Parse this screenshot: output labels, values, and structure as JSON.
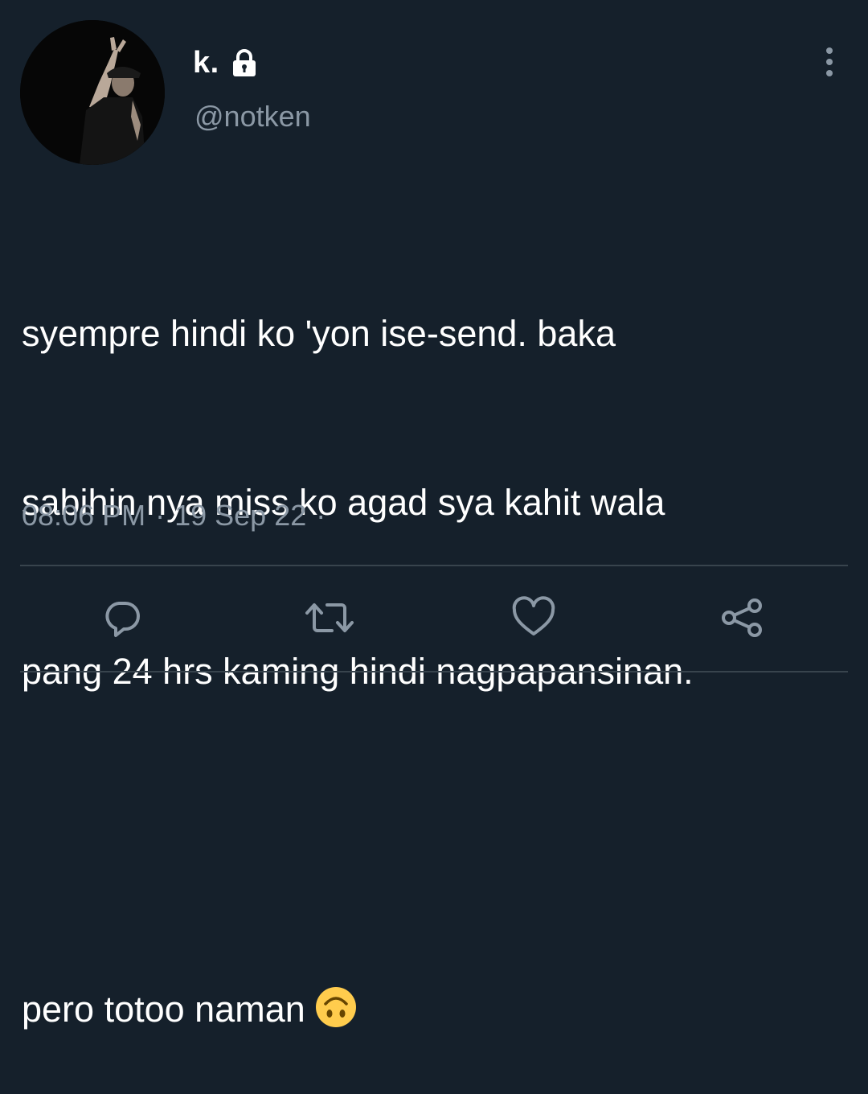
{
  "colors": {
    "background": "#15202b",
    "text_primary": "#ffffff",
    "text_secondary": "#8b98a5",
    "divider": "#38444d",
    "icon": "#8b98a5",
    "emoji_face": "#ffcc4d"
  },
  "tweet": {
    "author": {
      "display_name": "k.",
      "handle": "@notken",
      "protected_icon": "lock-icon"
    },
    "text_lines": [
      "syempre hindi ko 'yon ise-send. baka",
      "sabihin nya miss ko agad sya kahit wala",
      "pang 24 hrs kaming hindi nagpapansinan.",
      "",
      "pero totoo naman"
    ],
    "emoji": "upside-down-face-emoji",
    "time": "08:06 PM",
    "date": "19 Sep 22",
    "separator": "·"
  },
  "actions": [
    {
      "name": "reply",
      "icon": "reply-icon"
    },
    {
      "name": "retweet",
      "icon": "retweet-icon"
    },
    {
      "name": "like",
      "icon": "heart-icon"
    },
    {
      "name": "share",
      "icon": "share-icon"
    }
  ],
  "menu_icon": "more-vertical-icon"
}
